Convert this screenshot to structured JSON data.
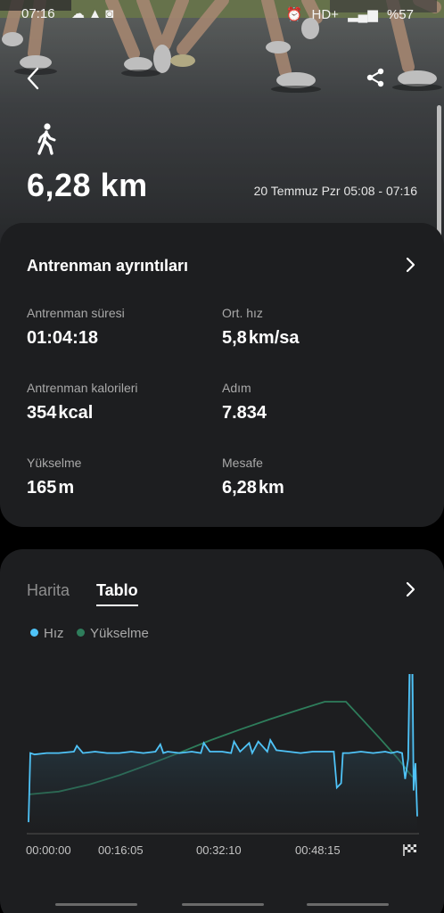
{
  "status_bar": {
    "time": "07:16",
    "network": "HD+",
    "battery": "%57"
  },
  "header": {
    "back_icon": "chevron-left-icon",
    "share_icon": "share-icon",
    "activity_icon": "walking-person-icon",
    "distance": "6,28 km",
    "date_range": "20 Temmuz Pzr 05:08 - 07:16"
  },
  "details": {
    "title": "Antrenman ayrıntıları",
    "stats": [
      {
        "label": "Antrenman süresi",
        "value": "01:04:18",
        "unit": ""
      },
      {
        "label": "Ort. hız",
        "value": "5,8",
        "unit": "km/sa"
      },
      {
        "label": "Antrenman kalorileri",
        "value": "354",
        "unit": "kcal"
      },
      {
        "label": "Adım",
        "value": "7.834",
        "unit": ""
      },
      {
        "label": "Yükselme",
        "value": "165",
        "unit": "m"
      },
      {
        "label": "Mesafe",
        "value": "6,28",
        "unit": "km"
      }
    ]
  },
  "chart_section": {
    "tabs": [
      "Harita",
      "Tablo"
    ],
    "active_tab": "Tablo",
    "legend": [
      {
        "name": "Hız",
        "color": "#4fc3f7"
      },
      {
        "name": "Yükselme",
        "color": "#2e7d5b"
      }
    ],
    "end_icon": "checkered-flag-icon"
  },
  "chart_data": {
    "type": "line",
    "x_tick_labels": [
      "00:00:00",
      "00:16:05",
      "00:32:10",
      "00:48:15"
    ],
    "x_unit": "minutes",
    "xlim": [
      0,
      64.3
    ],
    "series": [
      {
        "name": "Hız",
        "color": "#4fc3f7",
        "fill": true,
        "x": [
          0,
          0.3,
          1,
          3,
          5,
          7.5,
          8,
          9,
          11,
          13,
          15,
          17,
          19,
          21,
          21.8,
          22.3,
          23,
          25,
          27,
          28.5,
          29,
          30,
          32,
          33.5,
          34,
          35,
          36.5,
          37,
          38,
          39.5,
          40,
          41,
          43,
          45,
          47,
          49,
          50.5,
          51,
          51.7,
          52,
          53,
          55,
          57,
          59,
          60,
          61,
          61.8,
          62.3,
          62.8,
          63.1,
          63.4,
          63.7,
          64.0,
          64.3
        ],
        "y": [
          0.8,
          5.6,
          5.5,
          5.6,
          5.6,
          5.7,
          6.1,
          5.6,
          5.7,
          5.6,
          5.6,
          5.7,
          5.6,
          5.7,
          6.2,
          5.6,
          5.7,
          5.6,
          5.7,
          5.6,
          6.3,
          5.7,
          5.7,
          5.6,
          6.4,
          5.7,
          6.3,
          5.6,
          6.4,
          5.7,
          6.5,
          5.8,
          5.7,
          5.6,
          5.7,
          5.7,
          5.7,
          3.2,
          3.5,
          5.6,
          5.6,
          5.7,
          5.6,
          5.7,
          5.6,
          5.7,
          5.6,
          3.8,
          5.2,
          13.5,
          16.2,
          3.0,
          4.9,
          1.2
        ]
      },
      {
        "name": "Yükselme",
        "color": "#2e7d5b",
        "fill": false,
        "x": [
          0,
          5,
          10,
          15,
          20,
          25,
          30,
          35,
          40,
          45,
          49,
          52.5,
          55,
          58,
          61,
          63.5
        ],
        "y": [
          0,
          5,
          17,
          33,
          52,
          72,
          93,
          112,
          130,
          147,
          160,
          160,
          132,
          98,
          63,
          30
        ]
      }
    ]
  }
}
